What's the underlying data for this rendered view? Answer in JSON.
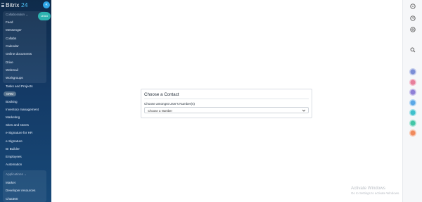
{
  "brand": {
    "name": "Bitrix",
    "version": "24"
  },
  "sidebar": {
    "collaboration_label": "Collaboration",
    "collab_items": [
      "Feed",
      "Messenger",
      "Collabs",
      "Calendar",
      "Online documents",
      "Drive",
      "Webmail",
      "Workgroups"
    ],
    "main_items_before_pill": [
      "Tasks and Projects"
    ],
    "pill": "CRM",
    "main_items": [
      "Booking",
      "Inventory management",
      "Marketing",
      "Sites and stores",
      "e-Signature for HR",
      "e-Signature",
      "BI Builder",
      "Employees",
      "Automation"
    ],
    "applications_label": "Applications",
    "app_items": [
      "Market",
      "Developer resources",
      "Chat360"
    ],
    "chevron": "⌄"
  },
  "collapse_button": {
    "icon": "chevron-left-icon",
    "glyph": "«"
  },
  "mini_tab": {
    "label": "LEAD"
  },
  "card": {
    "title": "Choose a Contact",
    "field_label": "Choose amongst User's Number(s)",
    "select_value": "Choose a Number"
  },
  "rightbar": {
    "icons": [
      "help-icon",
      "clock-icon",
      "chat-icon",
      "search-icon"
    ],
    "avatars": [
      {
        "name": "avatar-1",
        "color": "#7b8ed6"
      },
      {
        "name": "avatar-2",
        "color": "#e77e9b"
      },
      {
        "name": "avatar-3",
        "color": "#8e7fd6"
      },
      {
        "name": "avatar-4",
        "color": "#5aa7e6"
      },
      {
        "name": "avatar-5",
        "color": "#3fc0cc"
      },
      {
        "name": "avatar-6",
        "color": "#43c6a7"
      },
      {
        "name": "avatar-7",
        "color": "#f08a5d"
      }
    ]
  },
  "watermark": {
    "title": "Activate Windows",
    "subtitle": "Go to Settings to activate Windows."
  }
}
